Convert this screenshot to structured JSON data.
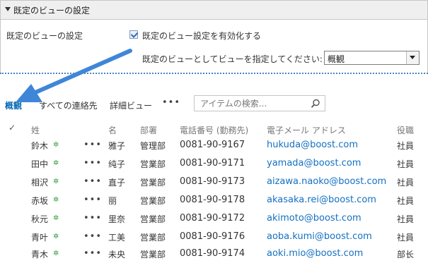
{
  "settings": {
    "header_title": "既定のビューの設定",
    "row_label": "既定のビューの設定",
    "enable_checkbox_label": "既定のビュー設定を有効化する",
    "enable_checked": true,
    "select_label": "既定のビューとしてビューを指定してください:",
    "select_value": "概観"
  },
  "views": {
    "overview": "概観",
    "all_contacts": "すべての連絡先",
    "detail": "詳細ビュー",
    "more": "•••",
    "search_placeholder": "アイテムの検索..."
  },
  "list": {
    "headers": {
      "check": "✓",
      "last_name": "姓",
      "first_name": "名",
      "department": "部署",
      "phone": "電話番号 (勤務先)",
      "email": "電子メール アドレス",
      "title": "役職"
    },
    "rows": [
      {
        "last_name": "鈴木",
        "first_name": "雅子",
        "department": "管理部",
        "phone": "0081-90-9167",
        "email": "hukuda@boost.com",
        "title": "社員"
      },
      {
        "last_name": "田中",
        "first_name": "纯子",
        "department": "営業部",
        "phone": "0081-90-9171",
        "email": "yamada@boost.com",
        "title": "社員"
      },
      {
        "last_name": "相沢",
        "first_name": "直子",
        "department": "営業部",
        "phone": "0081-90-9173",
        "email": "aizawa.naoko@boost.com",
        "title": "社員"
      },
      {
        "last_name": "赤坂",
        "first_name": "丽",
        "department": "営業部",
        "phone": "0081-90-9178",
        "email": "akasaka.rei@boost.com",
        "title": "社員"
      },
      {
        "last_name": "秋元",
        "first_name": "里奈",
        "department": "営業部",
        "phone": "0081-90-9172",
        "email": "akimoto@boost.com",
        "title": "社員"
      },
      {
        "last_name": "青叶",
        "first_name": "工美",
        "department": "営業部",
        "phone": "0081-90-9176",
        "email": "aoba.kumi@boost.com",
        "title": "社員"
      },
      {
        "last_name": "青木",
        "first_name": "未央",
        "department": "営業部",
        "phone": "0081-90-9174",
        "email": "aoki.mio@boost.com",
        "title": "部长"
      }
    ],
    "new_icon": "✲",
    "row_menu": "•••"
  },
  "colors": {
    "accent": "#0a6bb6",
    "link": "#1470c2",
    "arrow": "#3f86d8",
    "new_icon": "#2f9a3a"
  },
  "icons": [
    "collapse-triangle-icon",
    "checkbox-checked-icon",
    "dropdown-chevron-icon",
    "search-icon",
    "new-item-icon",
    "row-menu-icon",
    "arrow-pointer"
  ]
}
